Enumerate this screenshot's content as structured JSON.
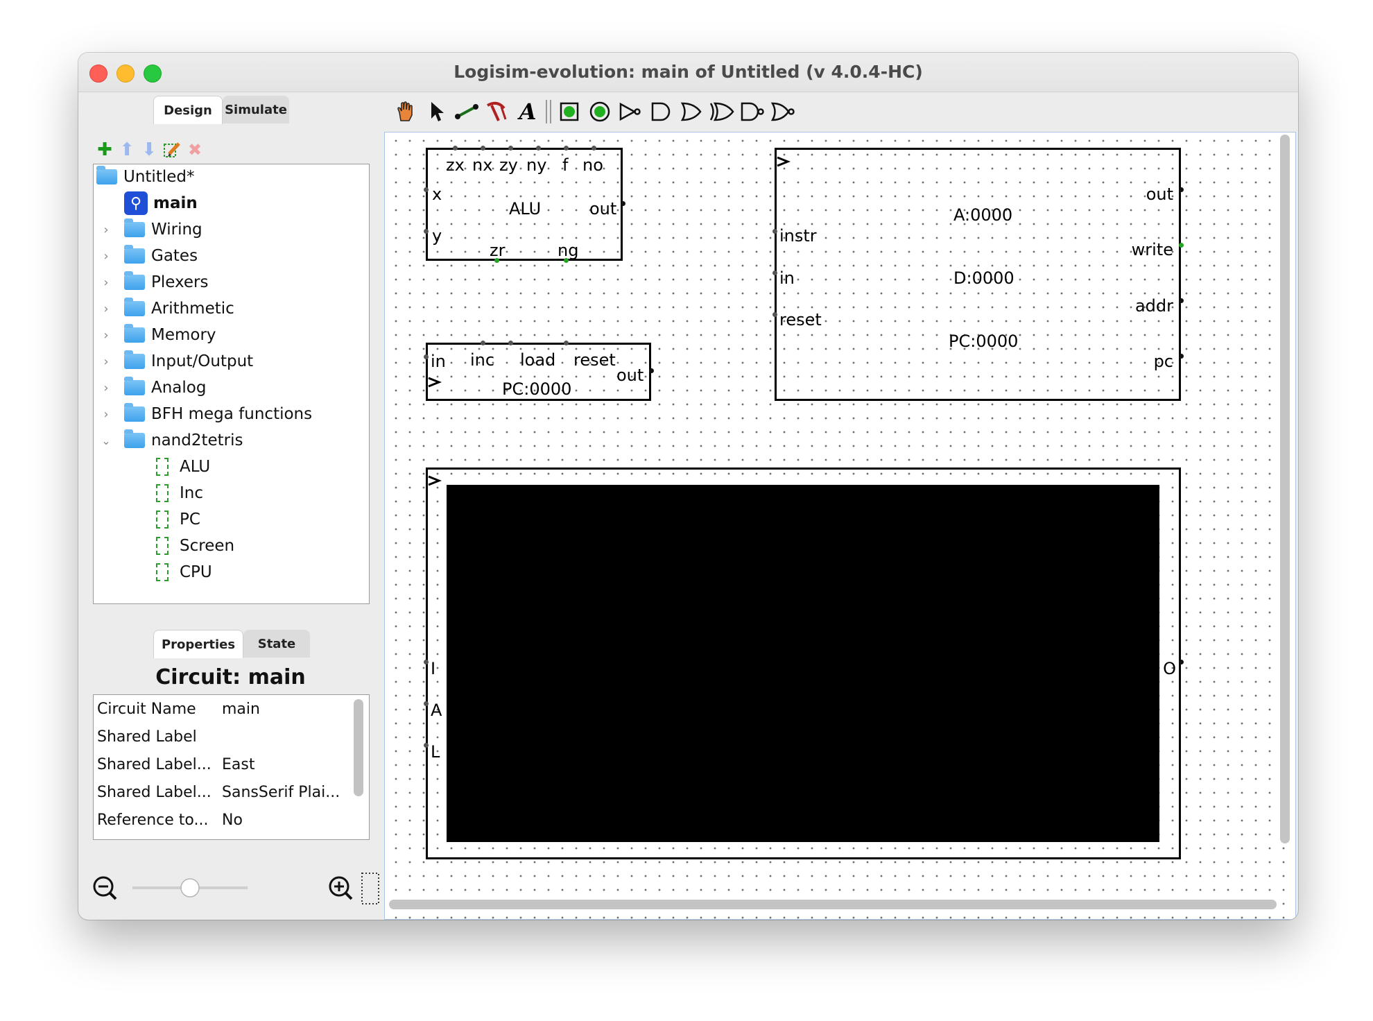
{
  "window": {
    "title": "Logisim-evolution: main of Untitled (v 4.0.4-HC)"
  },
  "design_tabs": [
    "Design",
    "Simulate"
  ],
  "tree_toolbar_icons": [
    "add-circuit-icon",
    "move-up-icon",
    "move-down-icon",
    "edit-appearance-icon",
    "delete-icon"
  ],
  "tree": {
    "project": "Untitled*",
    "main_circuit": "main",
    "libraries": [
      "Wiring",
      "Gates",
      "Plexers",
      "Arithmetic",
      "Memory",
      "Input/Output",
      "Analog",
      "BFH mega functions"
    ],
    "expanded_library": "nand2tetris",
    "expanded_items": [
      "ALU",
      "Inc",
      "PC",
      "Screen",
      "CPU"
    ]
  },
  "props_tabs": [
    "Properties",
    "State"
  ],
  "props": {
    "title": "Circuit: main",
    "rows": [
      {
        "key": "Circuit Name",
        "value": "main"
      },
      {
        "key": "Shared Label",
        "value": ""
      },
      {
        "key": "Shared Label...",
        "value": "East"
      },
      {
        "key": "Shared Label...",
        "value": "SansSerif Plai..."
      },
      {
        "key": "Reference to...",
        "value": "No"
      }
    ]
  },
  "zoom": {
    "level_fraction": 0.5
  },
  "tools": [
    "hand-poke-icon",
    "select-arrow-icon",
    "wiring-icon",
    "text-edit-icon",
    "text-tool-icon",
    "input-pin-icon",
    "output-pin-icon",
    "not-gate-icon",
    "and-gate-icon",
    "or-gate-icon",
    "xor-gate-icon",
    "nand-gate-icon",
    "nor-gate-icon"
  ],
  "colors": {
    "accent_pin": "#22a322",
    "screen": "#000000",
    "main_icon": "#1f4fd6"
  },
  "canvas": {
    "alu": {
      "top_inputs": [
        "zx",
        "nx",
        "zy",
        "ny",
        "f",
        "no"
      ],
      "x": "x",
      "y": "y",
      "name": "ALU",
      "out": "out",
      "zr": "zr",
      "ng": "ng"
    },
    "pc": {
      "in": "in",
      "inc": "inc",
      "load": "load",
      "reset": "reset",
      "out": "out",
      "value": "PC:0000"
    },
    "cpu": {
      "instr": "instr",
      "in": "in",
      "reset": "reset",
      "out": "out",
      "write": "write",
      "addr": "addr",
      "pc": "pc",
      "a_reg": "A:0000",
      "d_reg": "D:0000",
      "pc_reg": "PC:0000"
    },
    "screen": {
      "i": "I",
      "a": "A",
      "l": "L",
      "o": "O"
    }
  }
}
